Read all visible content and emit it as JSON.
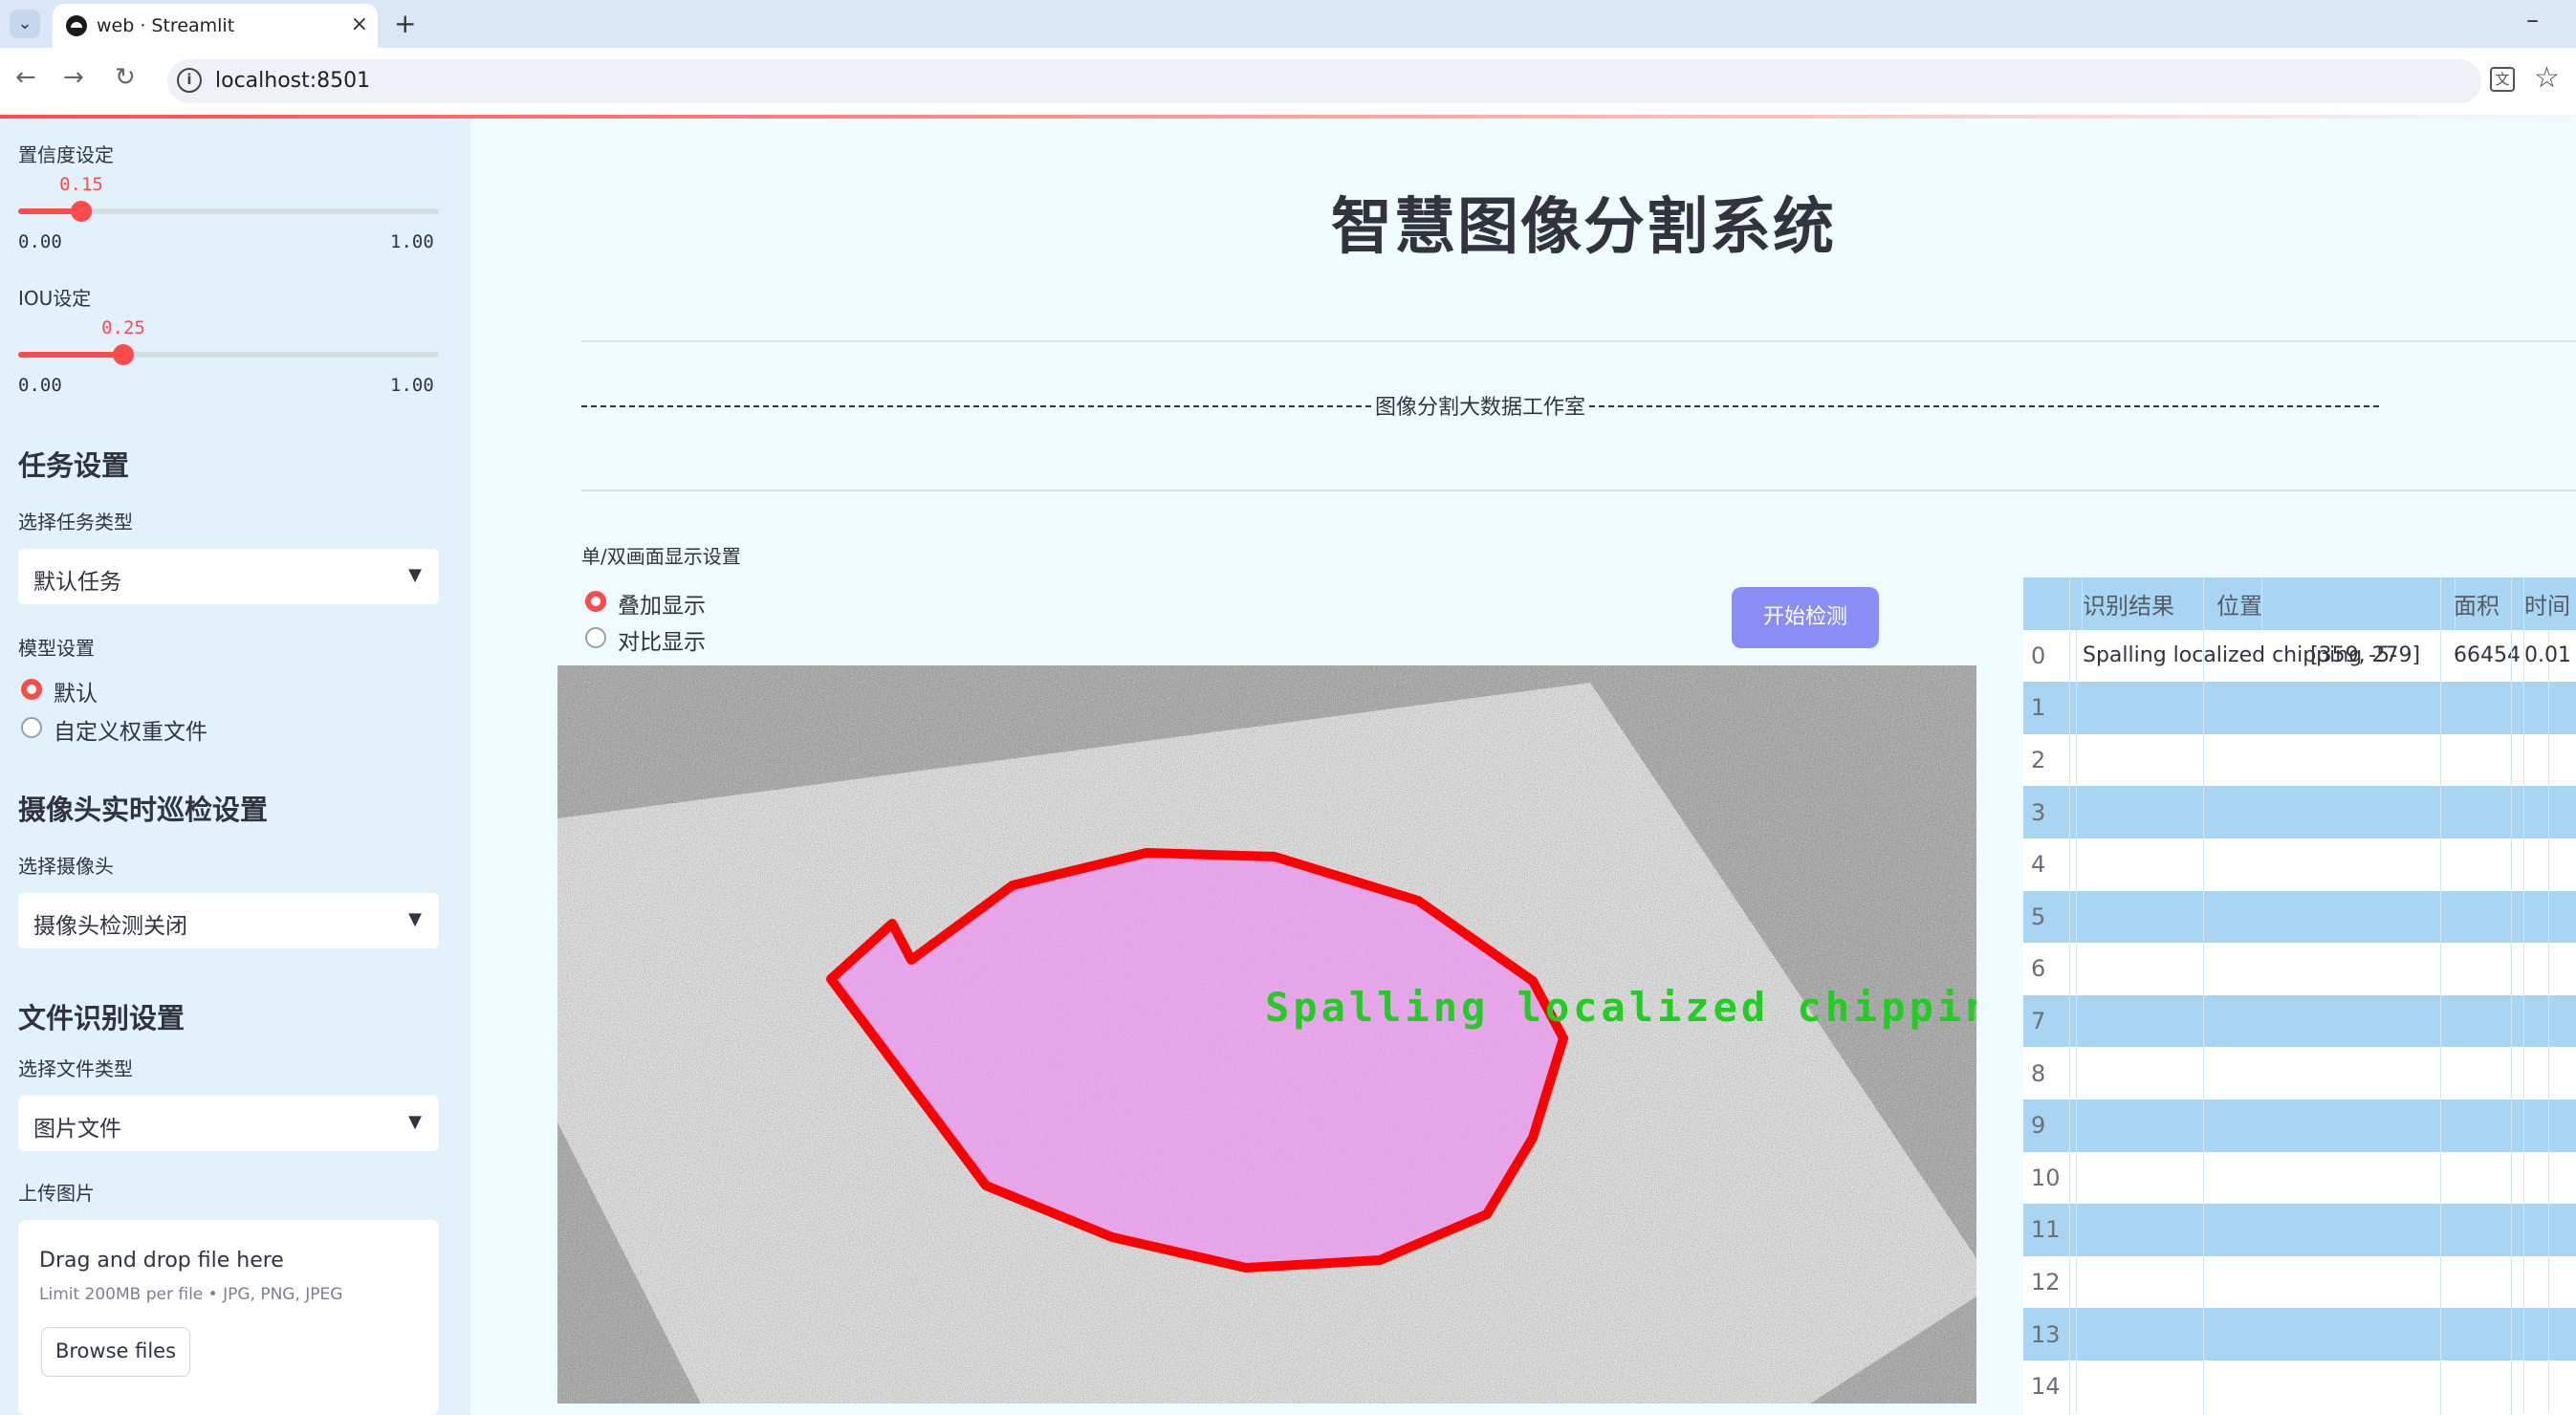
{
  "browser": {
    "tab_title": "web · Streamlit",
    "url": "localhost:8501"
  },
  "sidebar": {
    "confidence": {
      "label": "置信度设定",
      "value": "0.15",
      "min": "0.00",
      "max": "1.00",
      "fraction": 0.15
    },
    "iou": {
      "label": "IOU设定",
      "value": "0.25",
      "min": "0.00",
      "max": "1.00",
      "fraction": 0.25
    },
    "task_section": "任务设置",
    "task_type_label": "选择任务类型",
    "task_type_value": "默认任务",
    "model_label": "模型设置",
    "model_options": [
      "默认",
      "自定义权重文件"
    ],
    "model_selected": 0,
    "camera_section": "摄像头实时巡检设置",
    "camera_label": "选择摄像头",
    "camera_value": "摄像头检测关闭",
    "file_section": "文件识别设置",
    "file_type_label": "选择文件类型",
    "file_type_value": "图片文件",
    "upload_label": "上传图片",
    "upload_title": "Drag and drop file here",
    "upload_hint": "Limit 200MB per file • JPG, PNG, JPEG",
    "browse_label": "Browse files"
  },
  "main": {
    "title": "智慧图像分割系统",
    "studio_text": "图像分割大数据工作室",
    "display_label": "单/双画面显示设置",
    "display_options": [
      "叠加显示",
      "对比显示"
    ],
    "display_selected": 0,
    "start_button": "开始检测",
    "detection_label": "Spalling localized chipping"
  },
  "table": {
    "columns": [
      "",
      "识别结果",
      "位置",
      "面积",
      "时间"
    ],
    "rows": [
      {
        "index": "0",
        "result": "Spalling localized chipping -5-",
        "position": "[359, 279]",
        "area": "66454",
        "time": "0.01"
      },
      {
        "index": "1"
      },
      {
        "index": "2"
      },
      {
        "index": "3"
      },
      {
        "index": "4"
      },
      {
        "index": "5"
      },
      {
        "index": "6"
      },
      {
        "index": "7"
      },
      {
        "index": "8"
      },
      {
        "index": "9"
      },
      {
        "index": "10"
      },
      {
        "index": "11"
      },
      {
        "index": "12"
      },
      {
        "index": "13"
      },
      {
        "index": "14"
      }
    ]
  },
  "colors": {
    "accent": "#ff4b4b",
    "button": "#8a8df6",
    "mask_fill": "#e57ce8",
    "mask_outline": "#ff0000",
    "label_text": "#22cc22",
    "table_stripe": "#a9d4f2"
  }
}
